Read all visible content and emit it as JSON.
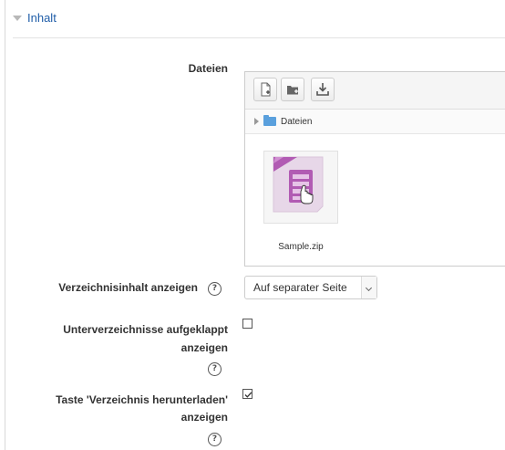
{
  "section": {
    "title": "Inhalt"
  },
  "files": {
    "label": "Dateien",
    "toolbar": {
      "icons": [
        "add-file-icon",
        "create-folder-icon",
        "download-icon"
      ]
    },
    "path": {
      "folder": "Dateien"
    },
    "items": [
      {
        "name": "Sample.zip",
        "icon": "zip-archive-icon"
      }
    ]
  },
  "display": {
    "label": "Verzeichnisinhalt anzeigen",
    "help_glyph": "?",
    "value": "Auf separater Seite"
  },
  "subfolders": {
    "label_line1": "Unterverzeichnisse aufgeklappt",
    "label_line2": "anzeigen",
    "help_glyph": "?",
    "checked": false
  },
  "download_button": {
    "label_line1": "Taste 'Verzeichnis herunterladen'",
    "label_line2": "anzeigen",
    "help_glyph": "?",
    "checked": true
  },
  "colors": {
    "link": "#1f5da8",
    "zip_purple": "#b15bb3",
    "folder_blue": "#5aa0dd"
  }
}
